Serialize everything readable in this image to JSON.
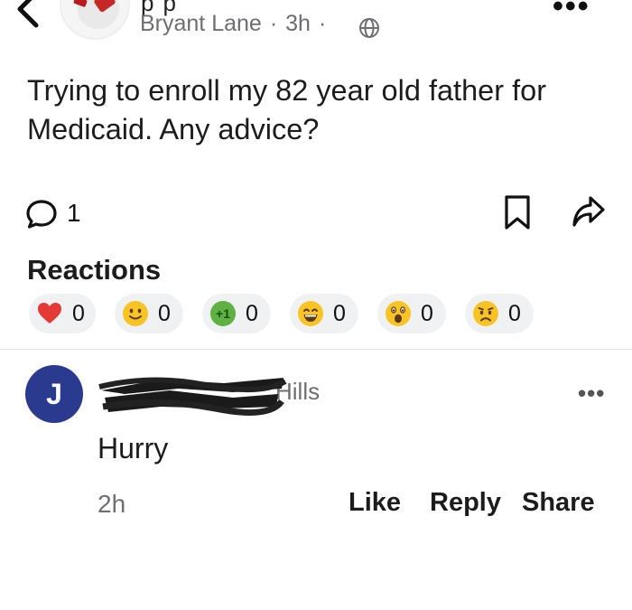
{
  "header": {
    "group_name_fragment": "pp",
    "author": "Bryant Lane",
    "separator": "·",
    "time": "3h",
    "more_glyph": "•••"
  },
  "post": {
    "text": "Trying to enroll my 82 year old father for Medicaid. Any advice?",
    "comment_count": "1"
  },
  "reactions": {
    "title": "Reactions",
    "items": [
      {
        "icon": "heart-icon",
        "count": "0"
      },
      {
        "icon": "smile-emoji-icon",
        "count": "0"
      },
      {
        "icon": "plus-one-icon",
        "icon_text": "+1",
        "count": "0"
      },
      {
        "icon": "grin-emoji-icon",
        "count": "0"
      },
      {
        "icon": "surprised-emoji-icon",
        "count": "0"
      },
      {
        "icon": "sad-emoji-icon",
        "count": "0"
      }
    ]
  },
  "comment": {
    "avatar_initial": "J",
    "author_visible": "Hills",
    "text": "Hurry",
    "time": "2h",
    "more_glyph": "•••",
    "actions": {
      "like": "Like",
      "reply": "Reply",
      "share": "Share"
    }
  },
  "colors": {
    "avatar_bg": "#2a3a8f",
    "heart": "#e53935",
    "emoji_yellow": "#f7c325",
    "plus_one_green": "#43a047",
    "pill_bg": "#f0f1f3"
  }
}
